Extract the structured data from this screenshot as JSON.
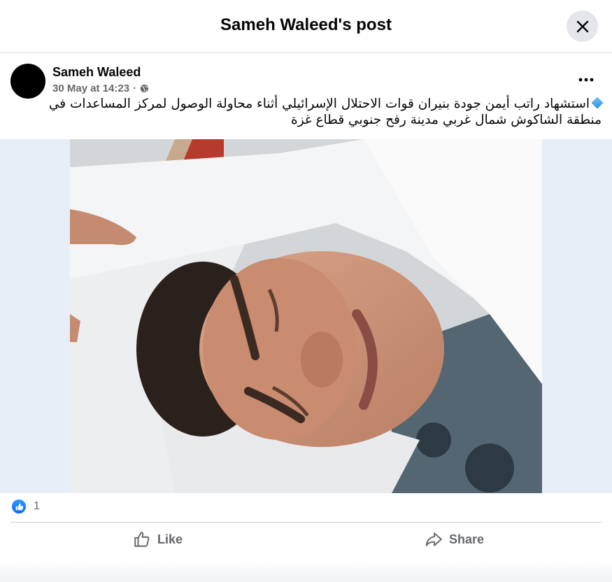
{
  "dialog": {
    "title": "Sameh Waleed's post",
    "close_icon": "close-icon"
  },
  "post": {
    "author": "Sameh Waleed",
    "timestamp": "30 May at 14:23",
    "separator": "·",
    "audience_icon": "globe-icon",
    "more_icon": "more-options-icon",
    "text": "استشهاد راتب أيمن جودة بنيران قوات الاحتلال الإسرائيلي أثناء محاولة الوصول لمركز المساعدات في منطقة الشاكوش شمال غربي مدينة رفح جنوبي قطاع غزة",
    "text_prefix_icon": "blue-diamond-emoji"
  },
  "reactions": {
    "icon": "like-reaction-icon",
    "count": "1"
  },
  "actions": {
    "like_label": "Like",
    "share_label": "Share"
  },
  "colors": {
    "accent": "#0866ff",
    "secondary_text": "#65676b",
    "button_bg": "#e4e6eb",
    "media_bg": "#e8eef8"
  }
}
